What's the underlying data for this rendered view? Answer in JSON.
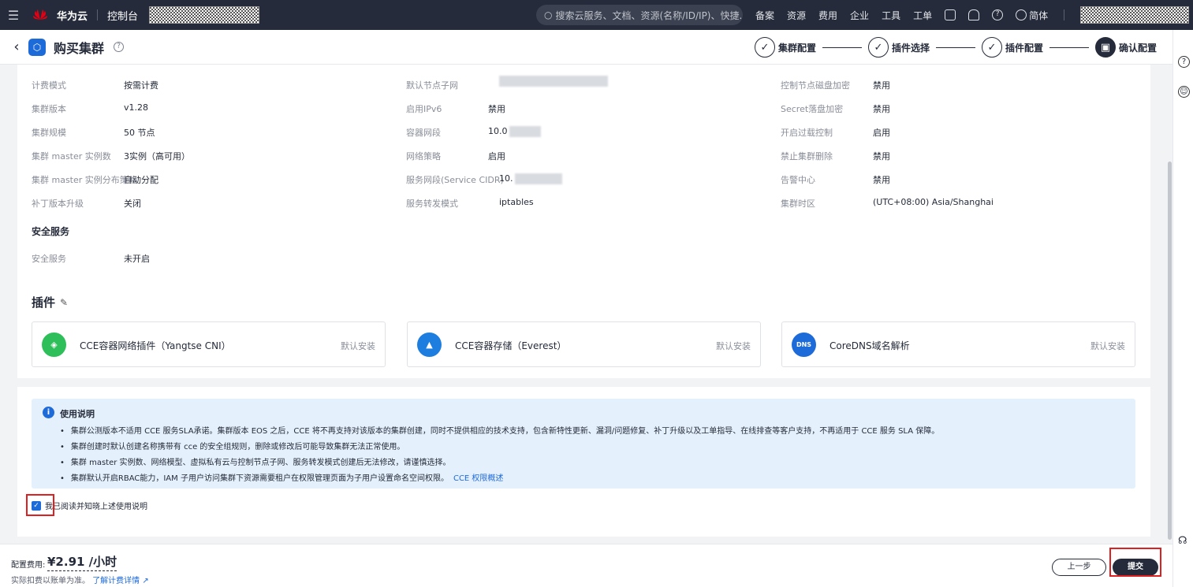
{
  "topnav": {
    "brand": "华为云",
    "console": "控制台",
    "search_placeholder": "搜索云服务、文档、资源(名称/ID/IP)、快捷...",
    "links": [
      "备案",
      "资源",
      "费用",
      "企业",
      "工具",
      "工单"
    ],
    "lang": "简体"
  },
  "header": {
    "title": "购买集群",
    "steps": [
      "集群配置",
      "插件选择",
      "插件配置",
      "确认配置"
    ]
  },
  "details": {
    "col1": [
      {
        "label": "计费模式",
        "value": "按需计费"
      },
      {
        "label": "集群版本",
        "value": "v1.28"
      },
      {
        "label": "集群规模",
        "value": "50 节点"
      },
      {
        "label": "集群 master 实例数",
        "value": "3实例（高可用）"
      },
      {
        "label": "集群 master 实例分布策略",
        "value": "自动分配"
      },
      {
        "label": "补丁版本升级",
        "value": "关闭"
      }
    ],
    "col2": [
      {
        "label": "默认节点子网",
        "value": ""
      },
      {
        "label": "启用IPv6",
        "value": "禁用"
      },
      {
        "label": "容器网段",
        "value": "10.0"
      },
      {
        "label": "网络策略",
        "value": "启用"
      },
      {
        "label": "服务网段(Service CIDR)",
        "value": "10."
      },
      {
        "label": "服务转发模式",
        "value": "iptables"
      }
    ],
    "col3": [
      {
        "label": "控制节点磁盘加密",
        "value": "禁用"
      },
      {
        "label": "Secret落盘加密",
        "value": "禁用"
      },
      {
        "label": "开启过载控制",
        "value": "启用"
      },
      {
        "label": "禁止集群删除",
        "value": "禁用"
      },
      {
        "label": "告警中心",
        "value": "禁用"
      },
      {
        "label": "集群时区",
        "value": "(UTC+08:00) Asia/Shanghai"
      }
    ],
    "security_title": "安全服务",
    "security_label": "安全服务",
    "security_value": "未开启"
  },
  "plugins": {
    "title": "插件",
    "items": [
      {
        "name": "CCE容器网络插件（Yangtse CNI）",
        "status": "默认安装",
        "color": "#2fbf5a"
      },
      {
        "name": "CCE容器存储（Everest）",
        "status": "默认安装",
        "color": "#1e7ee0"
      },
      {
        "name": "CoreDNS域名解析",
        "status": "默认安装",
        "color": "#1d6ad9"
      }
    ]
  },
  "notice": {
    "title": "使用说明",
    "items": [
      "集群公测版本不适用 CCE 服务SLA承诺。集群版本 EOS 之后，CCE 将不再支持对该版本的集群创建，同时不提供相应的技术支持，包含新特性更新、漏洞/问题修复、补丁升级以及工单指导、在线排查等客户支持，不再适用于 CCE 服务 SLA 保障。",
      "集群创建时默认创建名称携带有 cce 的安全组规则，删除或修改后可能导致集群无法正常使用。",
      "集群 master 实例数、网络模型、虚拟私有云与控制节点子网、服务转发模式创建后无法修改，请谨慎选择。",
      "集群默认开启RBAC能力，IAM 子用户访问集群下资源需要租户在权限管理页面为子用户设置命名空间权限。"
    ],
    "link": "CCE 权限概述",
    "agree": "我已阅读并知晓上述使用说明"
  },
  "footer": {
    "fee_label": "配置费用:",
    "fee_value": "¥2.91 /小时",
    "note": "实际扣费以账单为准。",
    "note_link": "了解计费详情",
    "prev": "上一步",
    "submit": "提交"
  }
}
